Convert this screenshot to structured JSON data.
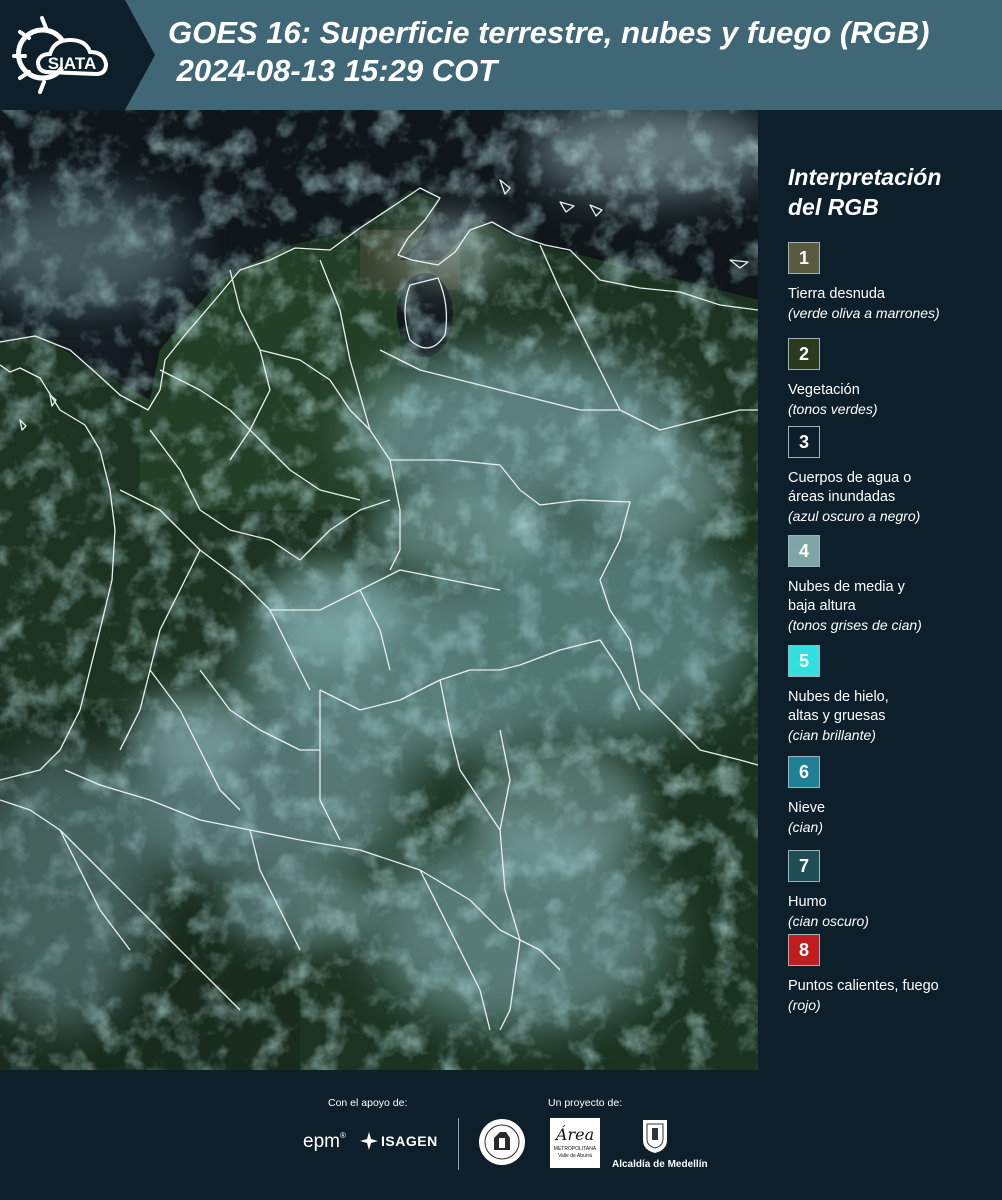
{
  "header": {
    "logo_text": "SIATA",
    "title_line1": "GOES 16: Superficie terrestre, nubes y fuego (RGB)",
    "title_line2": " 2024-08-13 15:29 COT"
  },
  "legend": {
    "title": "Interpretación del RGB",
    "items": [
      {
        "num": "1",
        "color": "#5a5a3e",
        "label": "Tierra desnuda",
        "sub": "(verde oliva a marrones)"
      },
      {
        "num": "2",
        "color": "#2b3a1c",
        "label": "Vegetación",
        "sub": "(tonos verdes)"
      },
      {
        "num": "3",
        "color": "#0d1f2b",
        "label": "Cuerpos de agua o áreas inundadas",
        "sub": "(azul oscuro a negro)"
      },
      {
        "num": "4",
        "color": "#7fa6a6",
        "label": "Nubes de media y baja altura",
        "sub": "(tonos grises de cian)"
      },
      {
        "num": "5",
        "color": "#32e0e0",
        "label": "Nubes de hielo, altas y gruesas",
        "sub": "(cian brillante)"
      },
      {
        "num": "6",
        "color": "#1e7f95",
        "label": "Nieve",
        "sub": "(cian)"
      },
      {
        "num": "7",
        "color": "#1f4f55",
        "label": "Humo",
        "sub": "(cian oscuro)"
      },
      {
        "num": "8",
        "color": "#c01e1e",
        "label": "Puntos calientes, fuego",
        "sub": "(rojo)"
      }
    ]
  },
  "footer": {
    "support_label": "Con el apoyo de:",
    "project_label": "Un proyecto de:",
    "epm_text": "epm",
    "isagen_text": "ISAGEN",
    "area_text": "Área",
    "area_sub": "METROPOLITANA",
    "area_sub2": "Valle de Aburrá",
    "alcaldia_text": "Alcaldía de Medellín"
  }
}
